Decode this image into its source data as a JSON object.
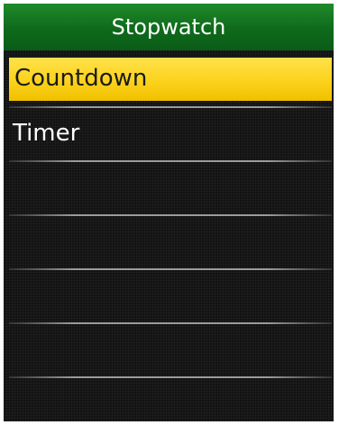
{
  "header": {
    "title": "Stopwatch"
  },
  "menu": {
    "items": [
      {
        "label": "Countdown",
        "selected": true
      },
      {
        "label": "Timer",
        "selected": false
      },
      {
        "label": "",
        "selected": false
      },
      {
        "label": "",
        "selected": false
      },
      {
        "label": "",
        "selected": false
      },
      {
        "label": "",
        "selected": false
      }
    ]
  },
  "colors": {
    "title_bar": "#127a22",
    "selection": "#fbd21c",
    "background": "#121212",
    "text": "#ffffff"
  }
}
